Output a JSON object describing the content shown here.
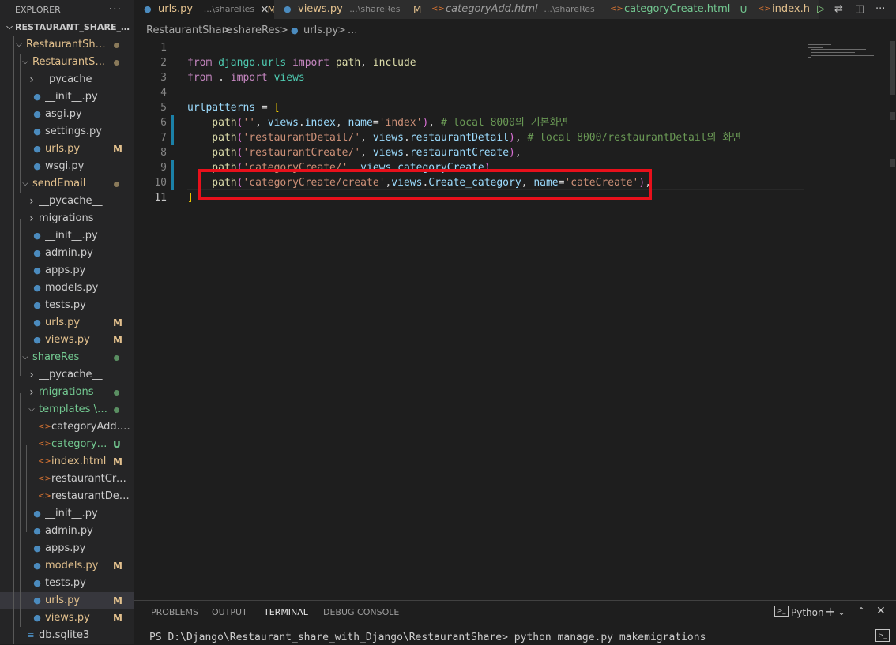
{
  "explorer": {
    "title": "EXPLORER",
    "more_icon": "ellipsis-icon",
    "more_glyph": "···",
    "tree": [
      {
        "label": "RESTAURANT_SHARE_WIT...",
        "type": "root",
        "open": true
      },
      {
        "label": "RestaurantShare",
        "type": "folder",
        "open": true,
        "color": "#e2c08d",
        "dot": true
      },
      {
        "label": "RestaurantShare",
        "type": "folder",
        "open": true,
        "color": "#e2c08d",
        "dot": true
      },
      {
        "label": "__pycache__",
        "type": "folder",
        "open": false
      },
      {
        "label": "__init__.py",
        "type": "py"
      },
      {
        "label": "asgi.py",
        "type": "py"
      },
      {
        "label": "settings.py",
        "type": "py"
      },
      {
        "label": "urls.py",
        "type": "py",
        "color": "#e2c08d",
        "badge": "M"
      },
      {
        "label": "wsgi.py",
        "type": "py"
      },
      {
        "label": "sendEmail",
        "type": "folder",
        "open": true,
        "color": "#e2c08d",
        "dot": true
      },
      {
        "label": "__pycache__",
        "type": "folder",
        "open": false
      },
      {
        "label": "migrations",
        "type": "folder",
        "open": false
      },
      {
        "label": "__init__.py",
        "type": "py"
      },
      {
        "label": "admin.py",
        "type": "py"
      },
      {
        "label": "apps.py",
        "type": "py"
      },
      {
        "label": "models.py",
        "type": "py"
      },
      {
        "label": "tests.py",
        "type": "py"
      },
      {
        "label": "urls.py",
        "type": "py",
        "color": "#e2c08d",
        "badge": "M"
      },
      {
        "label": "views.py",
        "type": "py",
        "color": "#e2c08d",
        "badge": "M"
      },
      {
        "label": "shareRes",
        "type": "folder",
        "open": true,
        "color": "#73c991",
        "dot": true
      },
      {
        "label": "__pycache__",
        "type": "folder",
        "open": false
      },
      {
        "label": "migrations",
        "type": "folder",
        "open": false,
        "color": "#73c991",
        "dot": true
      },
      {
        "label": "templates \\ s...",
        "type": "folder",
        "open": true,
        "color": "#73c991",
        "dot": true
      },
      {
        "label": "categoryAdd.html",
        "type": "html"
      },
      {
        "label": "categoryCre...",
        "type": "html",
        "color": "#73c991",
        "badge": "U"
      },
      {
        "label": "index.html",
        "type": "html",
        "color": "#e2c08d",
        "badge": "M"
      },
      {
        "label": "restaurantCreate....",
        "type": "html"
      },
      {
        "label": "restaurantDetail.h...",
        "type": "html"
      },
      {
        "label": "__init__.py",
        "type": "py"
      },
      {
        "label": "admin.py",
        "type": "py"
      },
      {
        "label": "apps.py",
        "type": "py"
      },
      {
        "label": "models.py",
        "type": "py",
        "color": "#e2c08d",
        "badge": "M"
      },
      {
        "label": "tests.py",
        "type": "py"
      },
      {
        "label": "urls.py",
        "type": "py",
        "color": "#e2c08d",
        "badge": "M",
        "selected": true
      },
      {
        "label": "views.py",
        "type": "py",
        "color": "#e2c08d",
        "badge": "M"
      },
      {
        "label": "db.sqlite3",
        "type": "db"
      }
    ]
  },
  "tabs": [
    {
      "name": "urls.py",
      "path": "...\\shareRes",
      "badge": "M",
      "active": true,
      "icon": "python-file-icon",
      "close": "×"
    },
    {
      "name": "views.py",
      "path": "...\\shareRes",
      "badge": "M",
      "icon": "python-file-icon"
    },
    {
      "name": "categoryAdd.html",
      "path": "...\\shareRes",
      "icon": "html-file-icon"
    },
    {
      "name": "categoryCreate.html",
      "badge": "U",
      "icon": "html-file-icon"
    },
    {
      "name": "index.h",
      "icon": "html-file-icon"
    }
  ],
  "breadcrumb": {
    "parts": [
      "RestaurantShare",
      ">",
      "shareRes",
      ">",
      "urls.py",
      ">",
      "..."
    ]
  },
  "code_lines": [
    {
      "num": "1",
      "tokens": []
    },
    {
      "num": "2",
      "tokens": [
        [
          "kw",
          "from "
        ],
        [
          "mod",
          "django.urls "
        ],
        [
          "kw",
          "import "
        ],
        [
          "fn",
          "path"
        ],
        [
          "pl",
          ", "
        ],
        [
          "fn",
          "include"
        ]
      ]
    },
    {
      "num": "3",
      "tokens": [
        [
          "kw",
          "from "
        ],
        [
          "pl",
          ". "
        ],
        [
          "kw",
          "import "
        ],
        [
          "mod",
          "views"
        ]
      ]
    },
    {
      "num": "4",
      "tokens": []
    },
    {
      "num": "5",
      "tokens": [
        [
          "var",
          "urlpatterns "
        ],
        [
          "pl",
          "= "
        ],
        [
          "br1",
          "["
        ]
      ]
    },
    {
      "num": "6",
      "mod": true,
      "tokens": [
        [
          "fn",
          "    path"
        ],
        [
          "br2",
          "("
        ],
        [
          "str",
          "''"
        ],
        [
          "pl",
          ", "
        ],
        [
          "var",
          "views"
        ],
        [
          "pl",
          "."
        ],
        [
          "var",
          "index"
        ],
        [
          "pl",
          ", "
        ],
        [
          "var",
          "name"
        ],
        [
          "pl",
          "="
        ],
        [
          "str",
          "'index'"
        ],
        [
          "br2",
          ")"
        ],
        [
          "pl",
          ", "
        ],
        [
          "cm",
          "# local 8000의 기본화면"
        ]
      ]
    },
    {
      "num": "7",
      "mod": true,
      "tokens": [
        [
          "fn",
          "    path"
        ],
        [
          "br2",
          "("
        ],
        [
          "str",
          "'restaurantDetail/'"
        ],
        [
          "pl",
          ", "
        ],
        [
          "var",
          "views"
        ],
        [
          "pl",
          "."
        ],
        [
          "var",
          "restaurantDetail"
        ],
        [
          "br2",
          ")"
        ],
        [
          "pl",
          ", "
        ],
        [
          "cm",
          "# local 8000/restaurantDetail의 화면"
        ]
      ]
    },
    {
      "num": "8",
      "tokens": [
        [
          "fn",
          "    path"
        ],
        [
          "br2",
          "("
        ],
        [
          "str",
          "'restaurantCreate/'"
        ],
        [
          "pl",
          ", "
        ],
        [
          "var",
          "views"
        ],
        [
          "pl",
          "."
        ],
        [
          "var",
          "restaurantCreate"
        ],
        [
          "br2",
          ")"
        ],
        [
          "pl",
          ","
        ]
      ]
    },
    {
      "num": "9",
      "mod": true,
      "tokens": [
        [
          "fn",
          "    path"
        ],
        [
          "br2",
          "("
        ],
        [
          "str",
          "'categoryCreate/'"
        ],
        [
          "pl",
          ", "
        ],
        [
          "var",
          "views"
        ],
        [
          "pl",
          "."
        ],
        [
          "var",
          "categoryCreate"
        ],
        [
          "br2",
          ")"
        ],
        [
          "pl",
          ","
        ]
      ]
    },
    {
      "num": "10",
      "mod": true,
      "tokens": [
        [
          "fn",
          "    path"
        ],
        [
          "br2",
          "("
        ],
        [
          "str",
          "'categoryCreate/create'"
        ],
        [
          "pl",
          ","
        ],
        [
          "var",
          "views"
        ],
        [
          "pl",
          "."
        ],
        [
          "var",
          "Create_category"
        ],
        [
          "pl",
          ", "
        ],
        [
          "var",
          "name"
        ],
        [
          "pl",
          "="
        ],
        [
          "str",
          "'cateCreate'"
        ],
        [
          "br2",
          ")"
        ],
        [
          "pl",
          ","
        ]
      ]
    },
    {
      "num": "11",
      "cur": true,
      "tokens": [
        [
          "br1",
          "]"
        ]
      ]
    }
  ],
  "panel": {
    "tabs": [
      "PROBLEMS",
      "OUTPUT",
      "TERMINAL",
      "DEBUG CONSOLE"
    ],
    "active_tab": "TERMINAL",
    "shell": "Python",
    "add_glyph": "+",
    "terminal_line": "PS D:\\Django\\Restaurant_share_with_Django\\RestaurantShare> python manage.py makemigrations"
  },
  "colors": {
    "highlight_box": "#e8101b",
    "modified": "#e2c08d",
    "untracked": "#73c991"
  }
}
